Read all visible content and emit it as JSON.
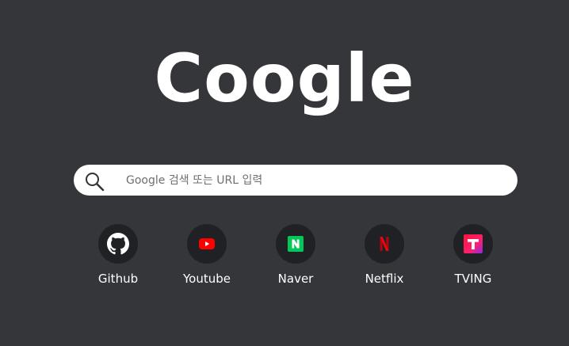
{
  "logo": {
    "text": "Coogle"
  },
  "search": {
    "placeholder": "Google 검색 또는 URL 입력",
    "value": ""
  },
  "shortcuts": [
    {
      "label": "Github",
      "icon": "github-icon",
      "color": "#ffffff"
    },
    {
      "label": "Youtube",
      "icon": "youtube-icon",
      "color": "#ff0000"
    },
    {
      "label": "Naver",
      "icon": "naver-icon",
      "color": "#03c75a"
    },
    {
      "label": "Netflix",
      "icon": "netflix-icon",
      "color": "#e50914"
    },
    {
      "label": "TVING",
      "icon": "tving-icon",
      "color": "#ff153c"
    }
  ],
  "colors": {
    "background": "#35363a",
    "tile": "#202124",
    "search_bar": "#ffffff"
  }
}
